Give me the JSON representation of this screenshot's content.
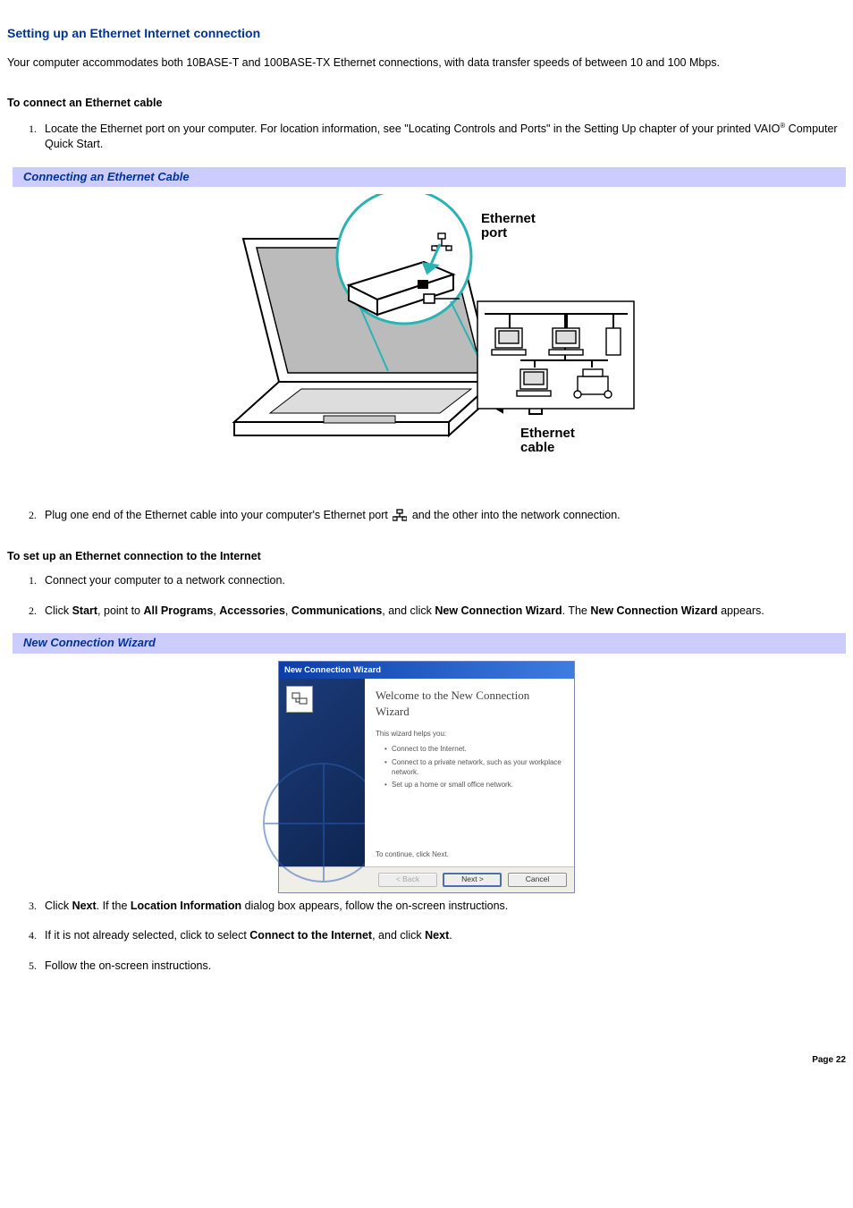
{
  "heading": "Setting up an Ethernet Internet connection",
  "intro": "Your computer accommodates both 10BASE-T and 100BASE-TX Ethernet connections, with data transfer speeds of between 10 and 100 Mbps.",
  "section1_title": "To connect an Ethernet cable",
  "section1_step1_a": "Locate the Ethernet port on your computer. For location information, see \"Locating Controls and Ports\" in the Setting Up chapter of your printed VAIO",
  "section1_step1_b": " Computer Quick Start.",
  "registered": "®",
  "bar1": "Connecting an Ethernet Cable",
  "ill_port_label": "Ethernet port",
  "ill_cable_label": "Ethernet cable",
  "section1_step2_a": "Plug one end of the Ethernet cable into your computer's Ethernet port ",
  "section1_step2_b": "and the other into the network connection.",
  "section2_title": "To set up an Ethernet connection to the Internet",
  "section2_steps": {
    "s1": "Connect your computer to a network connection.",
    "s2_a": "Click ",
    "s2_b": "Start",
    "s2_c": ", point to ",
    "s2_d": "All Programs",
    "s2_e": ", ",
    "s2_f": "Accessories",
    "s2_g": ", ",
    "s2_h": "Communications",
    "s2_i": ", and click ",
    "s2_j": "New Connection Wizard",
    "s2_k": ". The ",
    "s2_l": "New Connection Wizard",
    "s2_m": " appears.",
    "s3_a": "Click ",
    "s3_b": "Next",
    "s3_c": ". If the ",
    "s3_d": "Location Information",
    "s3_e": " dialog box appears, follow the on-screen instructions.",
    "s4_a": "If it is not already selected, click to select ",
    "s4_b": "Connect to the Internet",
    "s4_c": ", and click ",
    "s4_d": "Next",
    "s4_e": ".",
    "s5": "Follow the on-screen instructions."
  },
  "bar2": "New Connection Wizard",
  "wizard": {
    "titlebar": "New Connection Wizard",
    "welcome": "Welcome to the New Connection Wizard",
    "helps": "This wizard helps you:",
    "bullets": {
      "b1": "Connect to the Internet.",
      "b2": "Connect to a private network, such as your workplace network.",
      "b3": "Set up a home or small office network."
    },
    "continue": "To continue, click Next.",
    "buttons": {
      "back": "< Back",
      "next": "Next >",
      "cancel": "Cancel"
    }
  },
  "page_num": "Page 22"
}
